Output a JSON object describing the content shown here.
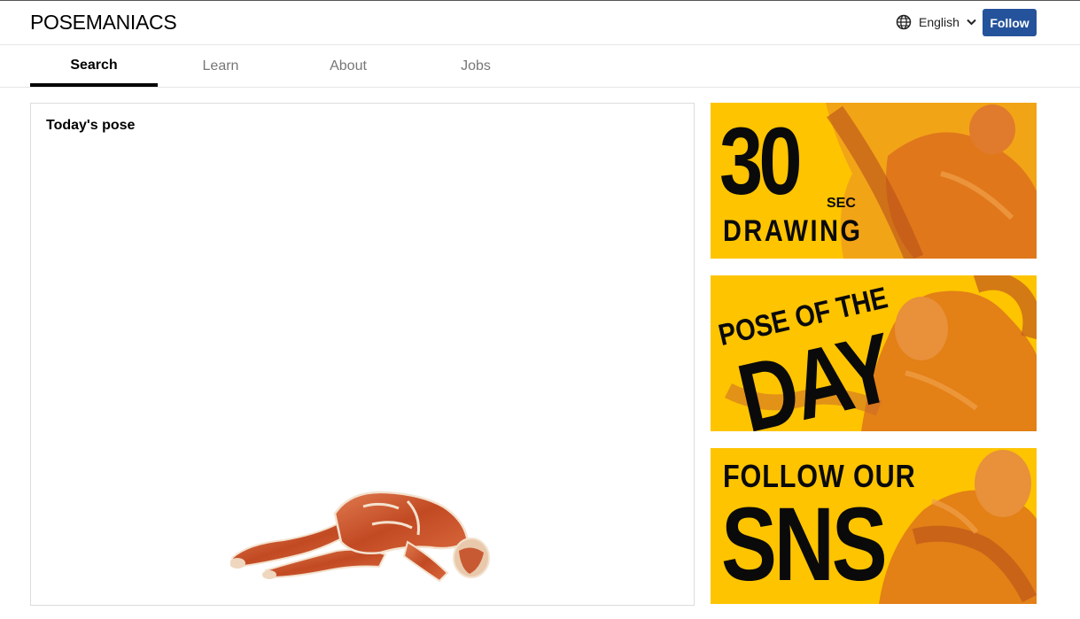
{
  "header": {
    "logo": "POSEMANIACS",
    "language": "English",
    "follow_label": "Follow"
  },
  "tabs": [
    {
      "label": "Search",
      "active": true
    },
    {
      "label": "Learn",
      "active": false
    },
    {
      "label": "About",
      "active": false
    },
    {
      "label": "Jobs",
      "active": false
    }
  ],
  "main": {
    "pose_title": "Today's pose"
  },
  "banners": [
    {
      "big": "30",
      "small": "SEC",
      "line2": "DRAWING"
    },
    {
      "line1": "POSE OF THE",
      "big": "DAY"
    },
    {
      "line1": "FOLLOW OUR",
      "big": "SNS"
    }
  ],
  "colors": {
    "accent": "#24539b",
    "banner_bg": "#fec400",
    "muscle": "#c9582c"
  }
}
